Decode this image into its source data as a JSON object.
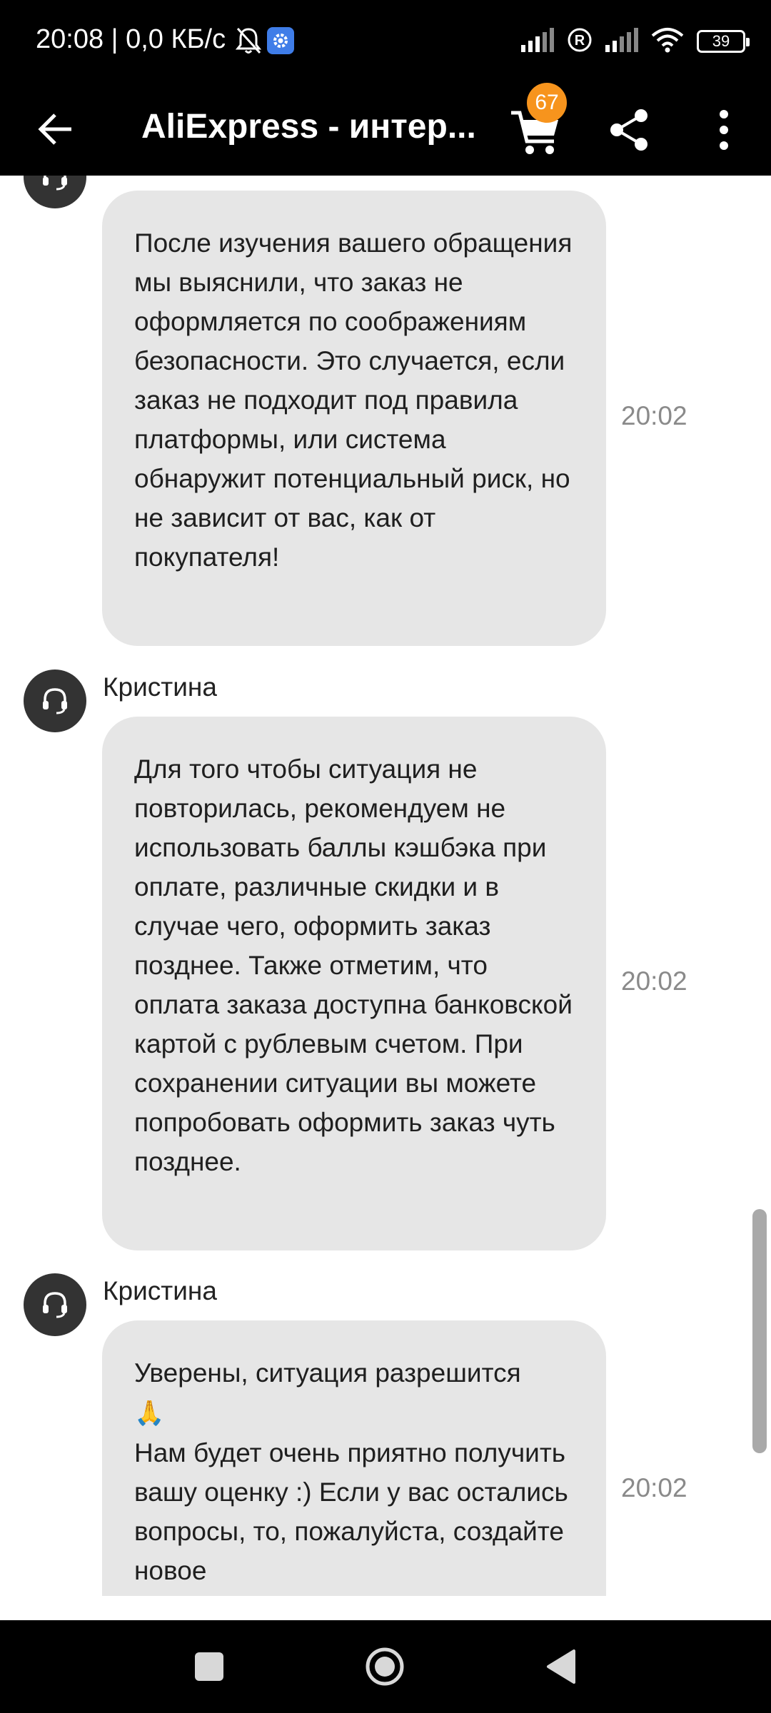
{
  "status_bar": {
    "text": "20:08 | 0,0 КБ/с",
    "battery": "39",
    "icons": [
      "bell-off-icon",
      "gear-icon",
      "signal-icon",
      "registered-icon",
      "signal-icon",
      "wifi-icon",
      "battery-icon"
    ]
  },
  "app_bar": {
    "title": "AliExpress - интер...",
    "cart_count": "67",
    "icons": [
      "back-arrow-icon",
      "cart-icon",
      "share-icon",
      "more-vert-icon"
    ]
  },
  "messages": [
    {
      "sender": "",
      "paragraphs": [
        "После изучения вашего обращения мы выяснили, что заказ не оформляется по соображениям безопасности. Это случается, если заказ не подходит под правила платформы, или система обнаружит потенциальный риск, но не зависит от вас, как от покупателя!"
      ],
      "time": "20:02"
    },
    {
      "sender": "Кристина",
      "paragraphs": [
        "Для того чтобы ситуация не повторилась, рекомендуем не использовать баллы кэшбэка при оплате, различные скидки и в случае чего, оформить заказ позднее. Также отметим, что оплата заказа доступна банковской картой с рублевым счетом. При сохранении ситуации вы можете попробовать оформить заказ чуть позднее."
      ],
      "time": "20:02"
    },
    {
      "sender": "Кристина",
      "paragraphs": [
        "Уверены, ситуация разрешится",
        "Нам будет очень приятно получить вашу оценку :) Если у вас остались вопросы, то, пожалуйста, создайте новое"
      ],
      "emoji": "🙏",
      "time": "20:02"
    }
  ],
  "nav_bar": {
    "icons": [
      "recents-square-icon",
      "home-circle-icon",
      "back-triangle-icon"
    ]
  },
  "colors": {
    "bar_background": "#000000",
    "bubble_background": "#e6e6e6",
    "badge": "#f7941d",
    "time_text": "#8a8a8a"
  }
}
